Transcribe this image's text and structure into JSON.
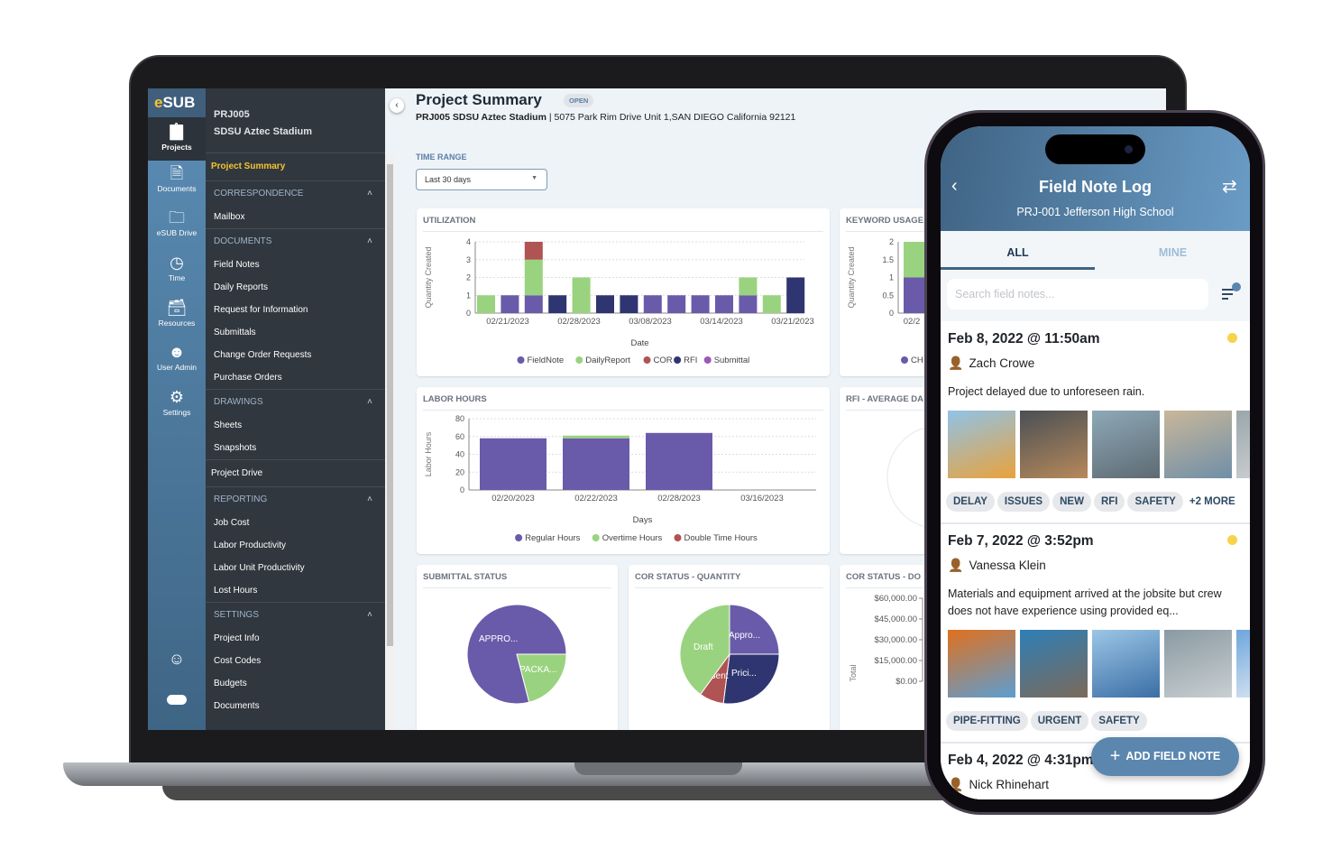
{
  "laptop": {
    "logo": {
      "e": "e",
      "rest": "SUB"
    },
    "rail": [
      {
        "label": "Projects",
        "icon": "clipboard-icon"
      },
      {
        "label": "Documents",
        "icon": "document-icon"
      },
      {
        "label": "eSUB Drive",
        "icon": "folder-icon"
      },
      {
        "label": "Time",
        "icon": "clock-icon"
      },
      {
        "label": "Resources",
        "icon": "archive-box-icon"
      },
      {
        "label": "User Admin",
        "icon": "users-icon"
      },
      {
        "label": "Settings",
        "icon": "gear-icon"
      }
    ],
    "project": {
      "code": "PRJ005",
      "name": "SDSU Aztec Stadium"
    },
    "nav": [
      {
        "type": "top",
        "label": "Project Summary",
        "active": true
      },
      {
        "type": "section",
        "label": "CORRESPONDENCE"
      },
      {
        "type": "item",
        "label": "Mailbox"
      },
      {
        "type": "section",
        "label": "DOCUMENTS"
      },
      {
        "type": "item",
        "label": "Field Notes"
      },
      {
        "type": "item",
        "label": "Daily Reports"
      },
      {
        "type": "item",
        "label": "Request for Information"
      },
      {
        "type": "item",
        "label": "Submittals"
      },
      {
        "type": "item",
        "label": "Change Order Requests"
      },
      {
        "type": "item",
        "label": "Purchase Orders"
      },
      {
        "type": "section",
        "label": "DRAWINGS"
      },
      {
        "type": "item",
        "label": "Sheets"
      },
      {
        "type": "item",
        "label": "Snapshots"
      },
      {
        "type": "top",
        "label": "Project Drive"
      },
      {
        "type": "section",
        "label": "REPORTING"
      },
      {
        "type": "item",
        "label": "Job Cost"
      },
      {
        "type": "item",
        "label": "Labor Productivity"
      },
      {
        "type": "item",
        "label": "Labor Unit Productivity"
      },
      {
        "type": "item",
        "label": "Lost Hours"
      },
      {
        "type": "section",
        "label": "SETTINGS"
      },
      {
        "type": "item",
        "label": "Project Info"
      },
      {
        "type": "item",
        "label": "Cost Codes"
      },
      {
        "type": "item",
        "label": "Budgets"
      },
      {
        "type": "item",
        "label": "Documents"
      }
    ],
    "page": {
      "title": "Project Summary",
      "status": "OPEN",
      "project_line": "PRJ005 SDSU Aztec Stadium",
      "address": "5075 Park Rim Drive Unit 1,SAN DIEGO California 92121",
      "time_range_label": "TIME RANGE",
      "time_range_value": "Last 30 days"
    },
    "colors": {
      "fieldnote": "#6a5aaa",
      "dailyreport": "#9ad37f",
      "cor": "#b05353",
      "rfi": "#2f3570",
      "submittal": "#9b59b6",
      "accent": "#f4c430"
    }
  },
  "chart_data": [
    {
      "type": "bar",
      "stacked": true,
      "title": "UTILIZATION",
      "xlabel": "Date",
      "ylabel": "Quantity Created",
      "ylim": [
        0,
        4
      ],
      "yticks": [
        0,
        1,
        2,
        3,
        4
      ],
      "grid": true,
      "legend": "bottom",
      "x_ticks": [
        "02/21/2023",
        "02/28/2023",
        "03/08/2023",
        "03/14/2023",
        "03/21/2023"
      ],
      "series": [
        {
          "name": "FieldNote",
          "color": "#6a5aaa",
          "values": [
            0,
            1,
            1,
            0,
            0,
            0,
            0,
            1,
            1,
            1,
            1,
            1,
            0,
            0
          ]
        },
        {
          "name": "DailyReport",
          "color": "#9ad37f",
          "values": [
            1,
            0,
            2,
            0,
            2,
            0,
            0,
            0,
            0,
            0,
            0,
            1,
            1,
            0
          ]
        },
        {
          "name": "COR",
          "color": "#b05353",
          "values": [
            0,
            0,
            1,
            0,
            0,
            0,
            0,
            0,
            0,
            0,
            0,
            0,
            0,
            0
          ]
        },
        {
          "name": "RFI",
          "color": "#2f3570",
          "values": [
            0,
            0,
            0,
            1,
            0,
            1,
            1,
            0,
            0,
            0,
            0,
            0,
            0,
            2
          ]
        },
        {
          "name": "Submittal",
          "color": "#9b59b6",
          "values": [
            0,
            0,
            0,
            0,
            0,
            0,
            0,
            0,
            0,
            0,
            0,
            0,
            0,
            0
          ]
        }
      ]
    },
    {
      "type": "bar",
      "stacked": true,
      "title": "KEYWORD USAGE",
      "ylabel": "Quantity Created",
      "ylim": [
        0,
        2
      ],
      "yticks": [
        "0",
        "0.5",
        "1",
        "1.5",
        "2"
      ],
      "x_ticks": [
        "02/2"
      ],
      "legend_visible": "CH",
      "series": [
        {
          "color": "#6a5aaa",
          "values": [
            1
          ]
        },
        {
          "color": "#9ad37f",
          "values": [
            1
          ]
        }
      ]
    },
    {
      "type": "bar",
      "stacked": true,
      "title": "LABOR HOURS",
      "xlabel": "Days",
      "ylabel": "Labor Hours",
      "ylim": [
        0,
        80
      ],
      "yticks": [
        0,
        20,
        40,
        60,
        80
      ],
      "grid": true,
      "legend": "bottom",
      "categories": [
        "02/20/2023",
        "02/22/2023",
        "02/28/2023",
        "03/16/2023"
      ],
      "series": [
        {
          "name": "Regular Hours",
          "color": "#6a5aaa",
          "values": [
            58,
            58,
            64,
            0
          ]
        },
        {
          "name": "Overtime Hours",
          "color": "#9ad37f",
          "values": [
            0,
            3,
            0,
            0
          ]
        },
        {
          "name": "Double Time Hours",
          "color": "#b05353",
          "values": [
            0,
            0,
            0,
            0
          ]
        }
      ]
    },
    {
      "type": "pie",
      "title": "RFI - AVERAGE DA"
    },
    {
      "type": "pie",
      "title": "SUBMITTAL STATUS",
      "slices": [
        {
          "label": "PACKA...",
          "value": 21,
          "color": "#9ad37f"
        },
        {
          "label": "APPRO...",
          "value": 79,
          "color": "#6a5aaa"
        }
      ]
    },
    {
      "type": "pie",
      "title": "COR STATUS - QUANTITY",
      "slices": [
        {
          "label": "Prici...",
          "value": 27,
          "color": "#2f3570"
        },
        {
          "label": "Sent",
          "value": 8,
          "color": "#b05353"
        },
        {
          "label": "Draft",
          "value": 40,
          "color": "#9ad37f"
        },
        {
          "label": "Appro...",
          "value": 25,
          "color": "#6a5aaa"
        }
      ]
    },
    {
      "type": "bar",
      "title": "COR STATUS - DO",
      "ylabel": "Total",
      "yticks": [
        "$60,000.00",
        "$45,000.00",
        "$30,000.00",
        "$15,000.00",
        "$0.00"
      ]
    }
  ],
  "phone": {
    "title": "Field Note Log",
    "subtitle": "PRJ-001 Jefferson High School",
    "tabs": [
      {
        "label": "ALL",
        "active": true
      },
      {
        "label": "MINE",
        "active": false
      }
    ],
    "search_placeholder": "Search field notes...",
    "notes": [
      {
        "date": "Feb 8, 2022 @ 11:50am",
        "author": "Zach Crowe",
        "text": "Project delayed due to unforeseen rain.",
        "tags": [
          "DELAY",
          "ISSUES",
          "NEW",
          "RFI",
          "SAFETY"
        ],
        "more": "+2 MORE",
        "status_color": "#f8d34a"
      },
      {
        "date": "Feb 7, 2022 @ 3:52pm",
        "author": "Vanessa Klein",
        "text": "Materials and equipment arrived at the jobsite but crew does not have experience using provided eq...",
        "tags": [
          "PIPE-FITTING",
          "URGENT",
          "SAFETY"
        ],
        "status_color": "#f8d34a"
      },
      {
        "date": "Feb 4, 2022 @ 4:31pm",
        "author": "Nick Rhinehart"
      }
    ],
    "fab_label": "ADD FIELD NOTE"
  }
}
